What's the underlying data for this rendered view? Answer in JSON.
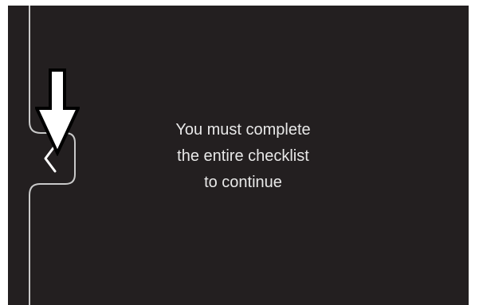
{
  "screen": {
    "background_color": "#231f20",
    "line_color": "#c9c9c9",
    "text_color": "#e8e8e8"
  },
  "back_tab": {
    "icon": "chevron-left-icon"
  },
  "message": {
    "lines": [
      "You must complete",
      "the entire checklist",
      "to continue"
    ]
  },
  "annotation": {
    "icon": "down-arrow-icon",
    "fill_color": "#ffffff",
    "stroke_color": "#000000"
  }
}
